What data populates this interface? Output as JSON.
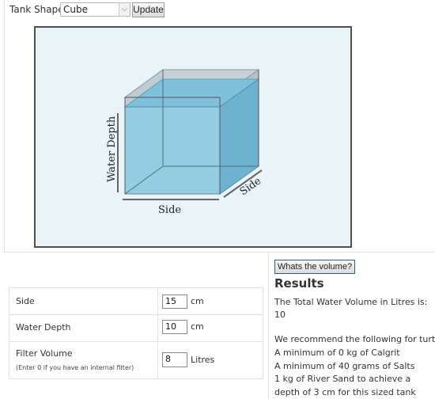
{
  "controls": {
    "tank_shape_label": "Tank Shape:",
    "tank_shape_value": "Cube",
    "update_label": "Update"
  },
  "diagram": {
    "depth_label": "Water Depth",
    "side_bottom_label": "Side",
    "side_diag_label": "Side"
  },
  "form": {
    "rows": [
      {
        "label": "Side",
        "value": "15",
        "unit": "cm"
      },
      {
        "label": "Water Depth",
        "value": "10",
        "unit": "cm"
      },
      {
        "label": "Filter Volume",
        "hint": "(Enter 0 if you have an internal filter)",
        "value": "8",
        "unit": "Litres"
      }
    ]
  },
  "results": {
    "button_label": "Whats the volume?",
    "heading": "Results",
    "volume_text": "The Total Water Volume in Litres is:",
    "volume_value": "10",
    "recommend_text": "We recommend the following for turtles",
    "line1": "A minimum of 0 kg of Calgrit",
    "line2": "A minimum of 40 grams of Salts",
    "line3": "1 kg of River Sand to achieve a",
    "line4": "depth of 3 cm for this sized tank"
  },
  "colors": {
    "water_front": "#8fcbe0",
    "water_top": "#6fb7d6",
    "glass": "#b8c6cc",
    "frame": "#4f4f4f"
  }
}
